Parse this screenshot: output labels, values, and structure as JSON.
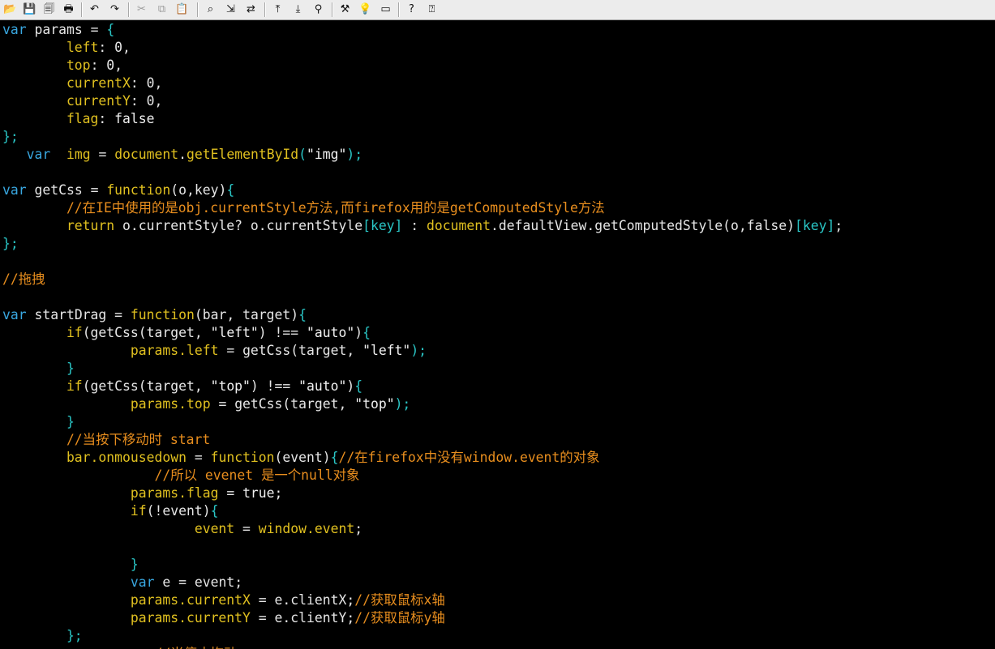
{
  "toolbar": {
    "buttons": [
      {
        "name": "open-icon",
        "glyph": "📂"
      },
      {
        "name": "save-icon",
        "glyph": "💾"
      },
      {
        "name": "save-all-icon",
        "glyph": "🗐"
      },
      {
        "name": "print-icon",
        "glyph": "🖶"
      },
      {
        "name": "undo-icon",
        "glyph": "↶"
      },
      {
        "name": "redo-icon",
        "glyph": "↷"
      },
      {
        "name": "cut-icon",
        "glyph": "✂"
      },
      {
        "name": "copy-icon",
        "glyph": "⧉"
      },
      {
        "name": "paste-icon",
        "glyph": "📋"
      },
      {
        "name": "find-icon",
        "glyph": "⌕"
      },
      {
        "name": "find-next-icon",
        "glyph": "⇲"
      },
      {
        "name": "replace-icon",
        "glyph": "⇄"
      },
      {
        "name": "upload-icon",
        "glyph": "⤒"
      },
      {
        "name": "download-icon",
        "glyph": "⤓"
      },
      {
        "name": "run-icon",
        "glyph": "⚲"
      },
      {
        "name": "tools-icon",
        "glyph": "⚒"
      },
      {
        "name": "bulb-icon",
        "glyph": "💡"
      },
      {
        "name": "highlight-icon",
        "glyph": "▭"
      },
      {
        "name": "help-icon",
        "glyph": "?"
      },
      {
        "name": "context-help-icon",
        "glyph": "⍰"
      }
    ]
  },
  "code": {
    "lines": [
      [
        {
          "t": "var",
          "c": "kw"
        },
        {
          "t": " params ",
          "c": "id"
        },
        {
          "t": "= ",
          "c": "op"
        },
        {
          "t": "{",
          "c": "punc"
        }
      ],
      [
        {
          "t": "        left",
          "c": "prop"
        },
        {
          "t": ": 0,",
          "c": "num"
        }
      ],
      [
        {
          "t": "        top",
          "c": "prop"
        },
        {
          "t": ": 0,",
          "c": "num"
        }
      ],
      [
        {
          "t": "        currentX",
          "c": "prop"
        },
        {
          "t": ": 0,",
          "c": "num"
        }
      ],
      [
        {
          "t": "        currentY",
          "c": "prop"
        },
        {
          "t": ": 0,",
          "c": "num"
        }
      ],
      [
        {
          "t": "        flag",
          "c": "prop"
        },
        {
          "t": ": false",
          "c": "bool"
        }
      ],
      [
        {
          "t": "};",
          "c": "punc"
        }
      ],
      [
        {
          "t": "   var",
          "c": "kw"
        },
        {
          "t": "  img ",
          "c": "prop"
        },
        {
          "t": "= ",
          "c": "op"
        },
        {
          "t": "document",
          "c": "fn"
        },
        {
          "t": ".",
          "c": "op"
        },
        {
          "t": "getElementById",
          "c": "fn"
        },
        {
          "t": "(",
          "c": "punc"
        },
        {
          "t": "\"img\"",
          "c": "str"
        },
        {
          "t": ");",
          "c": "punc"
        }
      ],
      [],
      [
        {
          "t": "var",
          "c": "kw"
        },
        {
          "t": " getCss ",
          "c": "id"
        },
        {
          "t": "= ",
          "c": "op"
        },
        {
          "t": "function",
          "c": "fn"
        },
        {
          "t": "(o,key)",
          "c": "id"
        },
        {
          "t": "{",
          "c": "punc"
        }
      ],
      [
        {
          "t": "        //在IE中使用的是obj.currentStyle方法,而firefox用的是getComputedStyle方法",
          "c": "com"
        }
      ],
      [
        {
          "t": "        return",
          "c": "prop"
        },
        {
          "t": " o.currentStyle? o.currentStyle",
          "c": "id"
        },
        {
          "t": "[key]",
          "c": "punc"
        },
        {
          "t": " : ",
          "c": "op"
        },
        {
          "t": "document",
          "c": "fn"
        },
        {
          "t": ".defaultView.getComputedStyle(o,false)",
          "c": "id"
        },
        {
          "t": "[key]",
          "c": "punc"
        },
        {
          "t": ";",
          "c": "op"
        }
      ],
      [
        {
          "t": "};",
          "c": "punc"
        }
      ],
      [],
      [
        {
          "t": "//拖拽",
          "c": "com"
        }
      ],
      [],
      [
        {
          "t": "var",
          "c": "kw"
        },
        {
          "t": " startDrag ",
          "c": "id"
        },
        {
          "t": "= ",
          "c": "op"
        },
        {
          "t": "function",
          "c": "fn"
        },
        {
          "t": "(bar, target)",
          "c": "id"
        },
        {
          "t": "{",
          "c": "punc"
        }
      ],
      [
        {
          "t": "        if",
          "c": "prop"
        },
        {
          "t": "(getCss(target, ",
          "c": "id"
        },
        {
          "t": "\"left\"",
          "c": "str"
        },
        {
          "t": ") !== ",
          "c": "op"
        },
        {
          "t": "\"auto\"",
          "c": "str"
        },
        {
          "t": ")",
          "c": "op"
        },
        {
          "t": "{",
          "c": "punc"
        }
      ],
      [
        {
          "t": "                params.left ",
          "c": "prop"
        },
        {
          "t": "= ",
          "c": "op"
        },
        {
          "t": "getCss(target, ",
          "c": "id"
        },
        {
          "t": "\"left\"",
          "c": "str"
        },
        {
          "t": ");",
          "c": "punc"
        }
      ],
      [
        {
          "t": "        }",
          "c": "punc"
        }
      ],
      [
        {
          "t": "        if",
          "c": "prop"
        },
        {
          "t": "(getCss(target, ",
          "c": "id"
        },
        {
          "t": "\"top\"",
          "c": "str"
        },
        {
          "t": ") !== ",
          "c": "op"
        },
        {
          "t": "\"auto\"",
          "c": "str"
        },
        {
          "t": ")",
          "c": "op"
        },
        {
          "t": "{",
          "c": "punc"
        }
      ],
      [
        {
          "t": "                params.top ",
          "c": "prop"
        },
        {
          "t": "= ",
          "c": "op"
        },
        {
          "t": "getCss(target, ",
          "c": "id"
        },
        {
          "t": "\"top\"",
          "c": "str"
        },
        {
          "t": ");",
          "c": "punc"
        }
      ],
      [
        {
          "t": "        }",
          "c": "punc"
        }
      ],
      [
        {
          "t": "        //当按下移动时 start",
          "c": "com"
        }
      ],
      [
        {
          "t": "        bar.onmousedown ",
          "c": "prop"
        },
        {
          "t": "= ",
          "c": "op"
        },
        {
          "t": "function",
          "c": "fn"
        },
        {
          "t": "(event)",
          "c": "id"
        },
        {
          "t": "{",
          "c": "punc"
        },
        {
          "t": "//在firefox中没有window.event的对象",
          "c": "com"
        }
      ],
      [
        {
          "t": "                   //所以 evenet 是一个null对象",
          "c": "com"
        }
      ],
      [
        {
          "t": "                params.flag ",
          "c": "prop"
        },
        {
          "t": "= ",
          "c": "op"
        },
        {
          "t": "true;",
          "c": "bool"
        }
      ],
      [
        {
          "t": "                if",
          "c": "prop"
        },
        {
          "t": "(!event)",
          "c": "id"
        },
        {
          "t": "{",
          "c": "punc"
        }
      ],
      [
        {
          "t": "                        event ",
          "c": "prop"
        },
        {
          "t": "= ",
          "c": "op"
        },
        {
          "t": "window.event",
          "c": "fn"
        },
        {
          "t": ";",
          "c": "op"
        }
      ],
      [],
      [
        {
          "t": "                }",
          "c": "punc"
        }
      ],
      [
        {
          "t": "                var",
          "c": "kw"
        },
        {
          "t": " e ",
          "c": "id"
        },
        {
          "t": "= ",
          "c": "op"
        },
        {
          "t": "event;",
          "c": "id"
        }
      ],
      [
        {
          "t": "                params.currentX ",
          "c": "prop"
        },
        {
          "t": "= ",
          "c": "op"
        },
        {
          "t": "e.clientX;",
          "c": "id"
        },
        {
          "t": "//获取鼠标x轴",
          "c": "com"
        }
      ],
      [
        {
          "t": "                params.currentY ",
          "c": "prop"
        },
        {
          "t": "= ",
          "c": "op"
        },
        {
          "t": "e.clientY;",
          "c": "id"
        },
        {
          "t": "//获取鼠标y轴",
          "c": "com"
        }
      ],
      [
        {
          "t": "        };",
          "c": "punc"
        }
      ],
      [
        {
          "t": "                   //当停止拖动",
          "c": "com"
        }
      ]
    ]
  }
}
